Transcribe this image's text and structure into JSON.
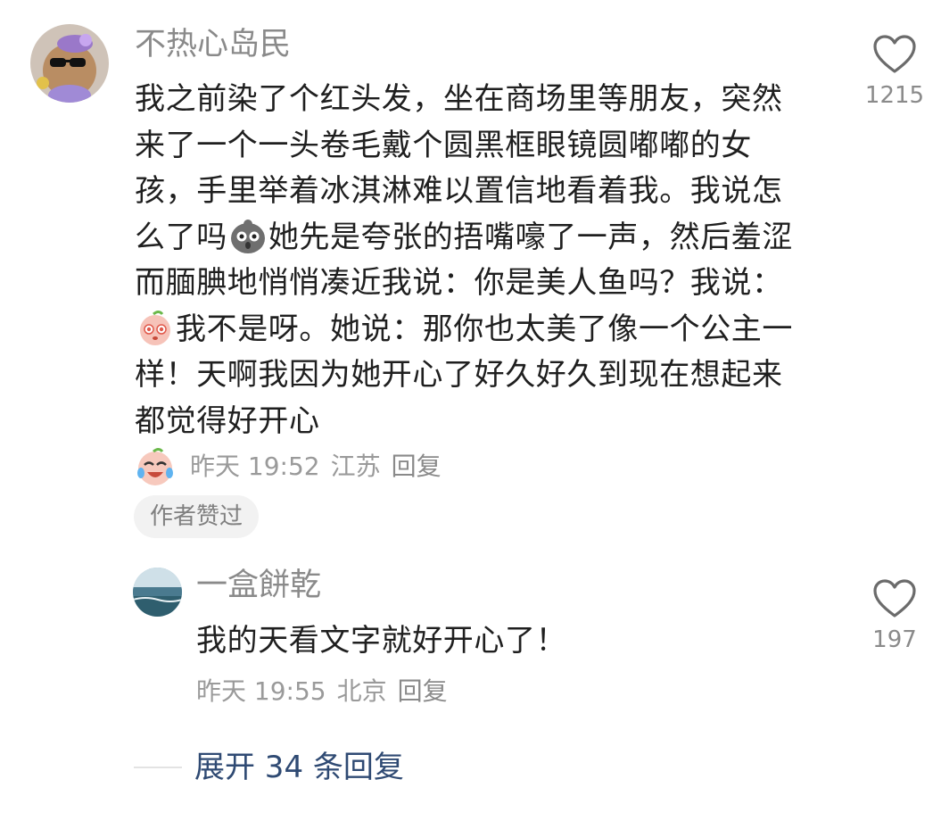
{
  "comment": {
    "username": "不热心岛民",
    "segments": [
      "我之前染了个红头发，坐在商场里等朋友，突然来了一个一头卷毛戴个圆黑框眼镜圆嘟嘟的女孩，手里举着冰淇淋难以置信地看着我。我说怎么了吗",
      "她先是夸张的捂嘴嚎了一声，然后羞涩而腼腆地悄悄凑近我说：你是美人鱼吗？我说：",
      "我不是呀。她说：那你也太美了像一个公主一样！天啊我因为她开心了好久好久到现在想起来都觉得好开心"
    ],
    "emoji_1": "shocked-pigeon-emoji",
    "emoji_2": "shy-peach-emoji",
    "time": "昨天 19:52",
    "location": "江苏",
    "reply_label": "回复",
    "likes": "1215",
    "author_badge": "作者赞过"
  },
  "reply": {
    "username": "一盒餅乾",
    "text": "我的天看文字就好开心了！",
    "time": "昨天 19:55",
    "location": "北京",
    "reply_label": "回复",
    "likes": "197"
  },
  "expand_label": "展开 34 条回复",
  "colors": {
    "username": "#8a8a8a",
    "body": "#1f1f1f",
    "meta": "#9a9a9a",
    "expand": "#2f4a73",
    "badge_bg": "#f2f2f2"
  }
}
